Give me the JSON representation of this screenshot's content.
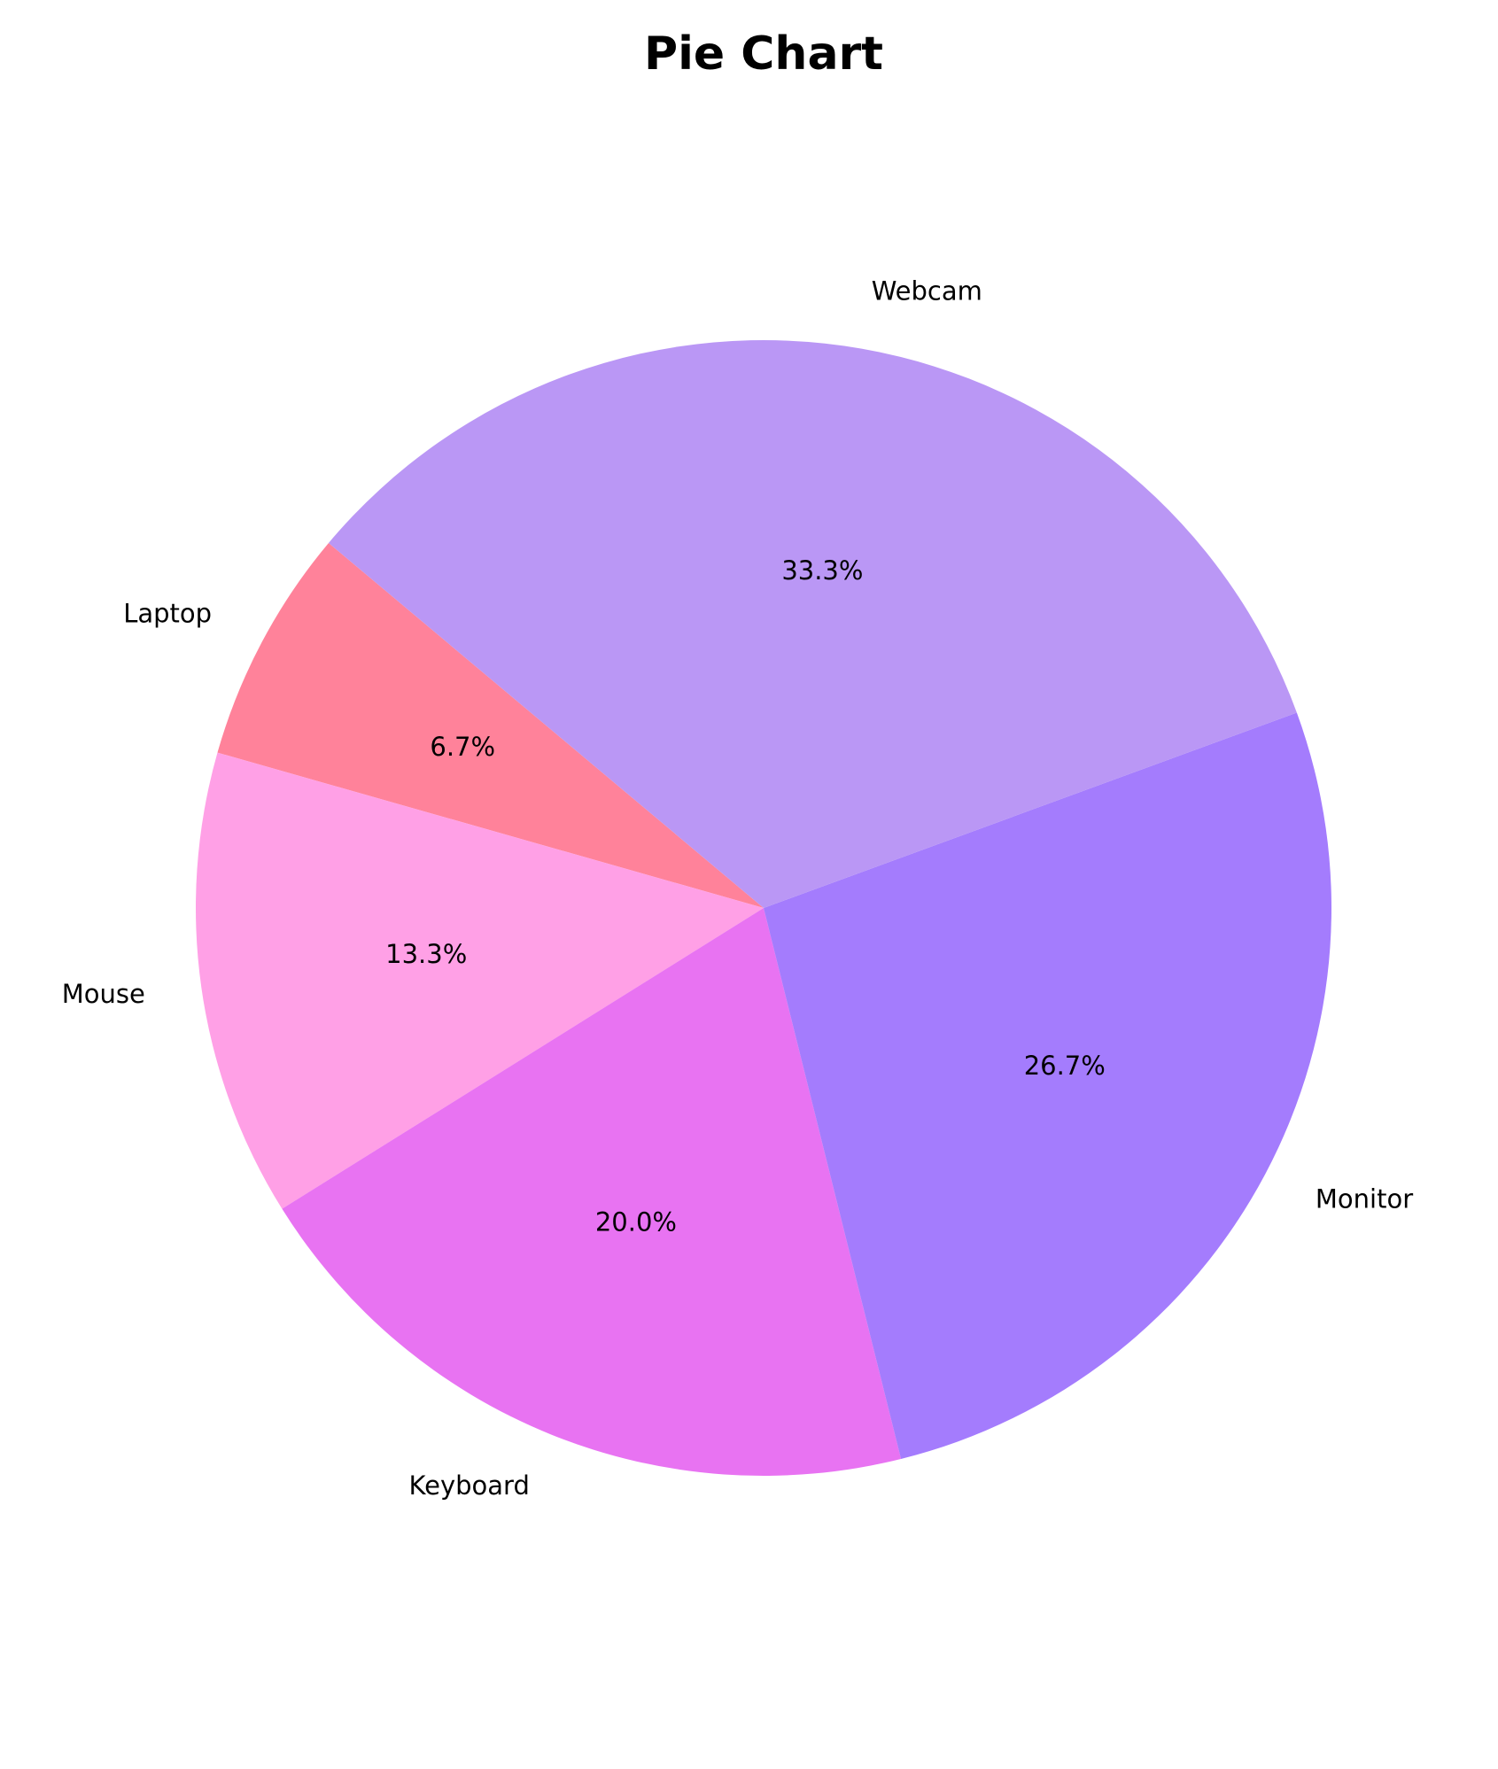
{
  "chart_data": {
    "type": "pie",
    "title": "Pie Chart",
    "labels": [
      "Laptop",
      "Mouse",
      "Keyboard",
      "Monitor",
      "Webcam"
    ],
    "values": [
      6.7,
      13.3,
      20.0,
      26.7,
      33.3
    ],
    "percent_labels": [
      "6.7%",
      "13.3%",
      "20.0%",
      "26.7%",
      "33.3%"
    ],
    "colors": [
      "#FF829A",
      "#FFA0E6",
      "#E873F2",
      "#A47CFD",
      "#BA97F5"
    ],
    "start_angle_deg": 140,
    "direction": "counterclockwise"
  }
}
